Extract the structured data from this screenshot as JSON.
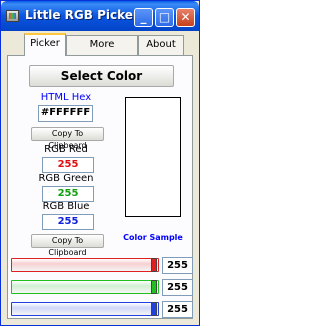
{
  "window": {
    "title": "Little RGB Picker",
    "minimize_glyph": "_",
    "maximize_glyph": "□",
    "close_glyph": "✕"
  },
  "tabs": [
    {
      "label": "Picker",
      "active": true
    },
    {
      "label": "More Software",
      "active": false
    },
    {
      "label": "About",
      "active": false
    }
  ],
  "picker": {
    "select_color_label": "Select Color",
    "html_hex_label": "HTML Hex",
    "html_hex_value": "#FFFFFF",
    "copy_button_label": "Copy To Clipboard",
    "red_label": "RGB Red",
    "red_value": "255",
    "green_label": "RGB Green",
    "green_value": "255",
    "blue_label": "RGB Blue",
    "blue_value": "255",
    "copy_button2_label": "Copy To Clipboard",
    "color_sample_label": "Color Sample",
    "sample_color": "#FFFFFF"
  },
  "sliders": [
    {
      "channel": "red",
      "value": "255",
      "level": 1.0,
      "color": "#e02020"
    },
    {
      "channel": "green",
      "value": "255",
      "level": 1.0,
      "color": "#20c020"
    },
    {
      "channel": "blue",
      "value": "255",
      "level": 1.0,
      "color": "#2040e0"
    }
  ],
  "colors": {
    "label_blue": "#0000ff",
    "red_text": "#e01010",
    "green_text": "#10a010",
    "blue_text": "#1020e0"
  }
}
